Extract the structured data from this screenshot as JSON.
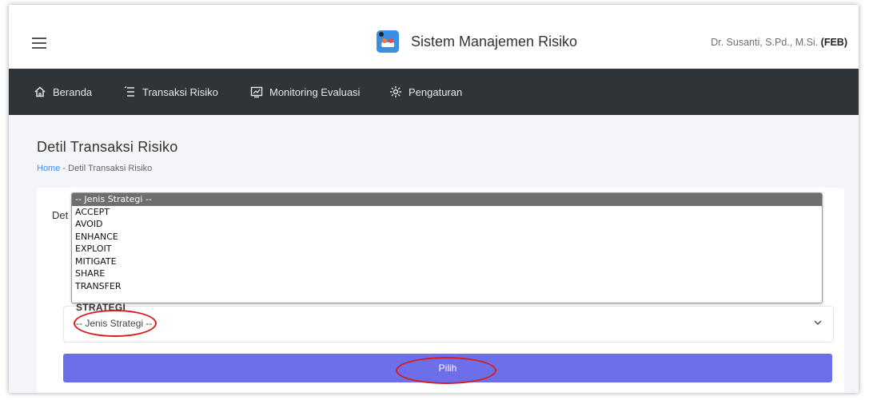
{
  "header": {
    "app_title": "Sistem Manajemen Risiko",
    "user_name": "Dr. Susanti, S.Pd., M.Si.",
    "user_unit": "(FEB)"
  },
  "nav": {
    "items": [
      {
        "label": "Beranda",
        "icon": "home-icon"
      },
      {
        "label": "Transaksi Risiko",
        "icon": "list-icon"
      },
      {
        "label": "Monitoring Evaluasi",
        "icon": "chart-icon"
      },
      {
        "label": "Pengaturan",
        "icon": "gear-icon"
      }
    ]
  },
  "page": {
    "title": "Detil Transaksi Risiko",
    "breadcrumb": {
      "home": "Home",
      "separator": "-",
      "current": "Detil Transaksi Risiko"
    },
    "card_title_fragment": "Det"
  },
  "form": {
    "strategy_label": "STRATEGI",
    "strategy_value": "-- Jenis Strategi --",
    "submit_label": "Pilih"
  },
  "dropdown": {
    "options": [
      "-- Jenis Strategi --",
      "ACCEPT",
      "AVOID",
      "ENHANCE",
      "EXPLOIT",
      "MITIGATE",
      "SHARE",
      "TRANSFER"
    ],
    "selected_index": 0
  },
  "colors": {
    "nav_bg": "#2f3439",
    "button_bg": "#6c6eea",
    "annotation": "#d91c1c",
    "breadcrumb_link": "#3d8bfd"
  }
}
